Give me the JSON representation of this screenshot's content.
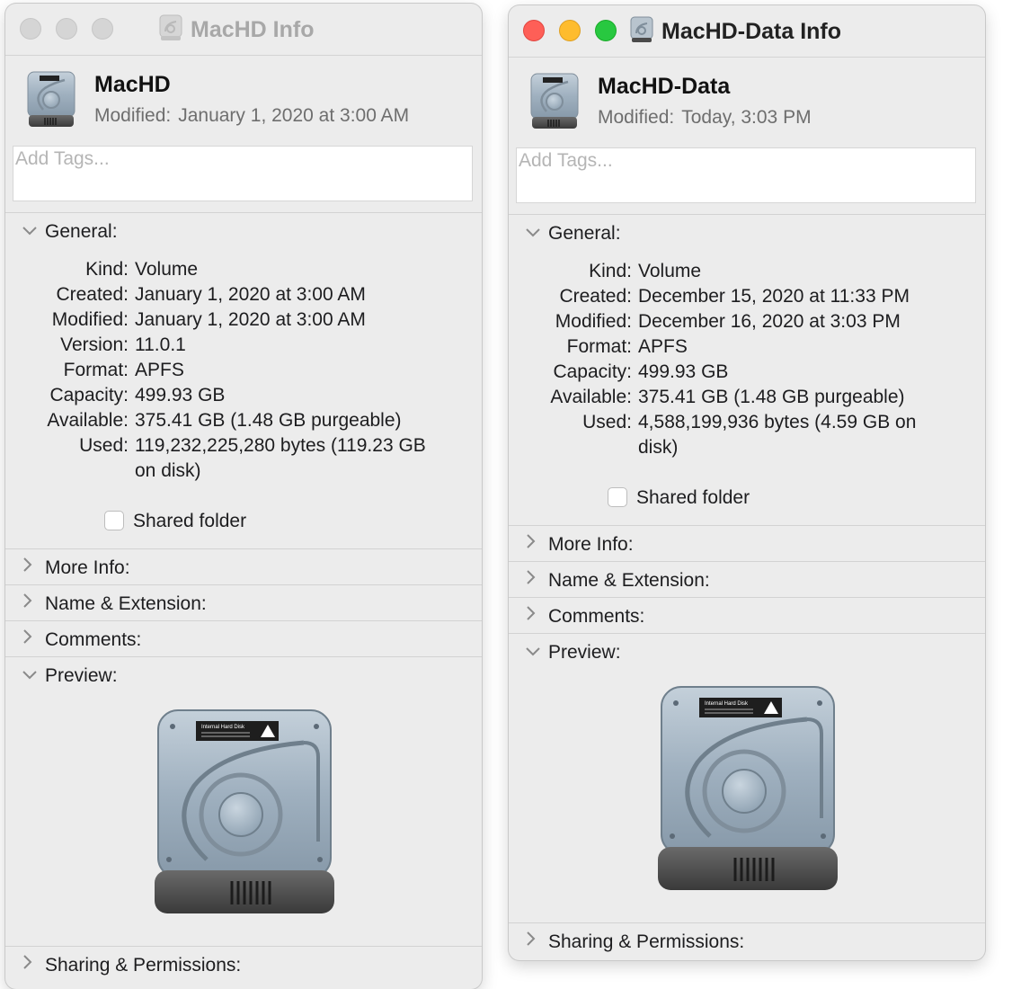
{
  "windows": [
    {
      "title": "MacHD Info",
      "name": "MacHD",
      "modified_label": "Modified:",
      "modified_value": "January 1, 2020 at 3:00 AM",
      "tags_placeholder": "Add Tags...",
      "general": {
        "heading": "General:",
        "rows": [
          {
            "k": "Kind:",
            "v": "Volume"
          },
          {
            "k": "Created:",
            "v": "January 1, 2020 at 3:00 AM"
          },
          {
            "k": "Modified:",
            "v": "January 1, 2020 at 3:00 AM"
          },
          {
            "k": "Version:",
            "v": "11.0.1"
          },
          {
            "k": "Format:",
            "v": "APFS"
          },
          {
            "k": "Capacity:",
            "v": "499.93 GB"
          },
          {
            "k": "Available:",
            "v": "375.41 GB (1.48 GB purgeable)"
          },
          {
            "k": "Used:",
            "v": "119,232,225,280 bytes (119.23 GB on disk)"
          }
        ],
        "shared_folder": "Shared folder"
      },
      "sections": {
        "more_info": "More Info:",
        "name_ext": "Name & Extension:",
        "comments": "Comments:",
        "preview": "Preview:",
        "sharing": "Sharing & Permissions:"
      },
      "disk_label": "Internal Hard Disk"
    },
    {
      "title": "MacHD-Data Info",
      "name": "MacHD-Data",
      "modified_label": "Modified:",
      "modified_value": "Today, 3:03 PM",
      "tags_placeholder": "Add Tags...",
      "general": {
        "heading": "General:",
        "rows": [
          {
            "k": "Kind:",
            "v": "Volume"
          },
          {
            "k": "Created:",
            "v": "December 15, 2020 at 11:33 PM"
          },
          {
            "k": "Modified:",
            "v": "December 16, 2020 at 3:03 PM"
          },
          {
            "k": "Format:",
            "v": "APFS"
          },
          {
            "k": "Capacity:",
            "v": "499.93 GB"
          },
          {
            "k": "Available:",
            "v": "375.41 GB (1.48 GB purgeable)"
          },
          {
            "k": "Used:",
            "v": "4,588,199,936 bytes (4.59 GB on disk)"
          }
        ],
        "shared_folder": "Shared folder"
      },
      "sections": {
        "more_info": "More Info:",
        "name_ext": "Name & Extension:",
        "comments": "Comments:",
        "preview": "Preview:",
        "sharing": "Sharing & Permissions:"
      },
      "disk_label": "Internal Hard Disk"
    }
  ],
  "colors": {
    "close": "#fe5f57",
    "minimize": "#febc2e",
    "zoom": "#28c840",
    "inactive_light": "#d5d5d5",
    "window_bg": "#ececec"
  },
  "icons": {
    "drive": "hard-drive-icon",
    "expanded": "chevron-down-icon",
    "collapsed": "chevron-right-icon"
  }
}
